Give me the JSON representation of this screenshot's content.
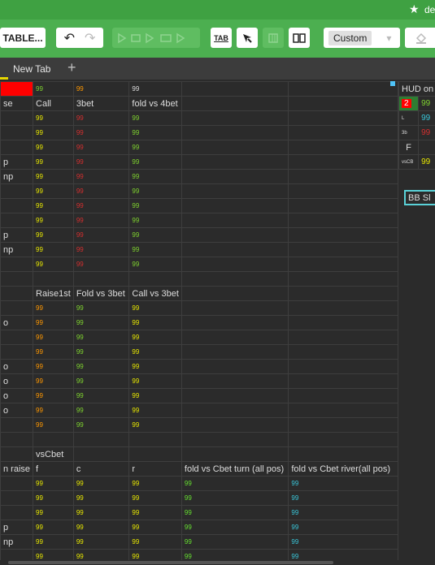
{
  "topbar": {
    "user_partial": "de",
    "star": "★"
  },
  "toolbar": {
    "table_button": "TABLE...",
    "undo": "↶",
    "redo": "↷",
    "tab_button": "TAB",
    "custom_select": "Custom",
    "custom_arrow": "▾"
  },
  "tabs": {
    "new_tab": "New Tab",
    "add": "+"
  },
  "colors": {
    "yellow": "#e8e800",
    "red": "#d32f2f",
    "green": "#7fd32f",
    "orange": "#ff9800",
    "cyan": "#39c6d9",
    "lime": "#66e030",
    "header_red": "#ff0000"
  },
  "grid": {
    "rows": [
      {
        "a": "",
        "b": "99",
        "c": "99",
        "d": "99",
        "e": "",
        "f": "",
        "g": "",
        "styles": [
          "red",
          "green",
          "orange",
          "white",
          "",
          "",
          ""
        ]
      },
      {
        "a": "se",
        "b": "Call",
        "c": "3bet",
        "d": "fold vs 4bet",
        "e": "",
        "f": "",
        "g": "",
        "styles": [
          "lbl",
          "lbl",
          "lbl",
          "lbl",
          "",
          "",
          ""
        ]
      },
      {
        "a": "",
        "b": "99",
        "c": "99",
        "d": "99",
        "e": "",
        "f": "",
        "g": "",
        "styles": [
          "",
          "yellow",
          "red",
          "green",
          "",
          "",
          ""
        ]
      },
      {
        "a": "",
        "b": "99",
        "c": "99",
        "d": "99",
        "e": "",
        "f": "",
        "g": "",
        "styles": [
          "",
          "yellow",
          "red",
          "green",
          "",
          "",
          ""
        ]
      },
      {
        "a": "",
        "b": "99",
        "c": "99",
        "d": "99",
        "e": "",
        "f": "",
        "g": "",
        "styles": [
          "",
          "yellow",
          "red",
          "green",
          "",
          "",
          ""
        ]
      },
      {
        "a": "p",
        "b": "99",
        "c": "99",
        "d": "99",
        "e": "",
        "f": "",
        "g": "",
        "styles": [
          "lbl",
          "yellow",
          "red",
          "green",
          "",
          "",
          ""
        ]
      },
      {
        "a": "np",
        "b": "99",
        "c": "99",
        "d": "99",
        "e": "",
        "f": "",
        "g": "",
        "styles": [
          "lbl",
          "yellow",
          "red",
          "green",
          "",
          "",
          ""
        ]
      },
      {
        "a": "",
        "b": "99",
        "c": "99",
        "d": "99",
        "e": "",
        "f": "",
        "g": "",
        "styles": [
          "",
          "yellow",
          "red",
          "green",
          "",
          "",
          ""
        ]
      },
      {
        "a": "",
        "b": "99",
        "c": "99",
        "d": "99",
        "e": "",
        "f": "",
        "g": "",
        "styles": [
          "",
          "yellow",
          "red",
          "green",
          "",
          "",
          ""
        ]
      },
      {
        "a": "",
        "b": "99",
        "c": "99",
        "d": "99",
        "e": "",
        "f": "",
        "g": "",
        "styles": [
          "",
          "yellow",
          "red",
          "green",
          "",
          "",
          ""
        ]
      },
      {
        "a": "p",
        "b": "99",
        "c": "99",
        "d": "99",
        "e": "",
        "f": "",
        "g": "",
        "styles": [
          "lbl",
          "yellow",
          "red",
          "green",
          "",
          "",
          ""
        ]
      },
      {
        "a": "np",
        "b": "99",
        "c": "99",
        "d": "99",
        "e": "",
        "f": "",
        "g": "",
        "styles": [
          "lbl",
          "yellow",
          "red",
          "green",
          "",
          "",
          ""
        ]
      },
      {
        "a": "",
        "b": "99",
        "c": "99",
        "d": "99",
        "e": "",
        "f": "",
        "g": "",
        "styles": [
          "",
          "yellow",
          "red",
          "green",
          "",
          "",
          ""
        ]
      },
      {
        "a": "",
        "b": "",
        "c": "",
        "d": "",
        "e": "",
        "f": "",
        "g": "",
        "styles": [
          "",
          "",
          "",
          "",
          "",
          "",
          ""
        ]
      },
      {
        "a": "",
        "b": "Raise1st",
        "c": "Fold vs 3bet",
        "d": "Call vs 3bet",
        "e": "",
        "f": "",
        "g": "",
        "styles": [
          "",
          "lbl",
          "lbl",
          "lbl",
          "",
          "",
          ""
        ]
      },
      {
        "a": "",
        "b": "99",
        "c": "99",
        "d": "99",
        "e": "",
        "f": "",
        "g": "",
        "styles": [
          "",
          "orange",
          "green",
          "yellow",
          "",
          "",
          ""
        ]
      },
      {
        "a": "o",
        "b": "99",
        "c": "99",
        "d": "99",
        "e": "",
        "f": "",
        "g": "",
        "styles": [
          "lbl",
          "orange",
          "green",
          "yellow",
          "",
          "",
          ""
        ]
      },
      {
        "a": "",
        "b": "99",
        "c": "99",
        "d": "99",
        "e": "",
        "f": "",
        "g": "",
        "styles": [
          "",
          "orange",
          "green",
          "yellow",
          "",
          "",
          ""
        ]
      },
      {
        "a": "",
        "b": "99",
        "c": "99",
        "d": "99",
        "e": "",
        "f": "",
        "g": "",
        "styles": [
          "",
          "orange",
          "green",
          "yellow",
          "",
          "",
          ""
        ]
      },
      {
        "a": "o",
        "b": "99",
        "c": "99",
        "d": "99",
        "e": "",
        "f": "",
        "g": "",
        "styles": [
          "lbl",
          "orange",
          "green",
          "yellow",
          "",
          "",
          ""
        ]
      },
      {
        "a": "o",
        "b": "99",
        "c": "99",
        "d": "99",
        "e": "",
        "f": "",
        "g": "",
        "styles": [
          "lbl",
          "orange",
          "green",
          "yellow",
          "",
          "",
          ""
        ]
      },
      {
        "a": "o",
        "b": "99",
        "c": "99",
        "d": "99",
        "e": "",
        "f": "",
        "g": "",
        "styles": [
          "lbl",
          "orange",
          "green",
          "yellow",
          "",
          "",
          ""
        ]
      },
      {
        "a": "o",
        "b": "99",
        "c": "99",
        "d": "99",
        "e": "",
        "f": "",
        "g": "",
        "styles": [
          "lbl",
          "orange",
          "green",
          "yellow",
          "",
          "",
          ""
        ]
      },
      {
        "a": "",
        "b": "99",
        "c": "99",
        "d": "99",
        "e": "",
        "f": "",
        "g": "",
        "styles": [
          "",
          "orange",
          "green",
          "yellow",
          "",
          "",
          ""
        ]
      },
      {
        "a": "",
        "b": "",
        "c": "",
        "d": "",
        "e": "",
        "f": "",
        "g": "",
        "styles": [
          "",
          "",
          "",
          "",
          "",
          "",
          ""
        ]
      },
      {
        "a": "",
        "b": "vsCbet",
        "c": "",
        "d": "",
        "e": "",
        "f": "",
        "g": "",
        "styles": [
          "",
          "lbl",
          "",
          "",
          "",
          "",
          ""
        ]
      },
      {
        "a": "n raise",
        "b": "f",
        "c": "c",
        "d": "r",
        "e": "fold vs Cbet turn  (all pos)",
        "f": "fold vs Cbet river(all pos)",
        "g": "",
        "styles": [
          "lbl",
          "lbl",
          "lbl",
          "lbl",
          "lbl",
          "lbl",
          ""
        ]
      },
      {
        "a": "",
        "b": "99",
        "c": "99",
        "d": "99",
        "e": "99",
        "f": "99",
        "g": "",
        "styles": [
          "",
          "yellow",
          "yellow",
          "yellow",
          "lime",
          "cyan",
          ""
        ]
      },
      {
        "a": "",
        "b": "99",
        "c": "99",
        "d": "99",
        "e": "99",
        "f": "99",
        "g": "",
        "styles": [
          "",
          "yellow",
          "yellow",
          "yellow",
          "lime",
          "cyan",
          ""
        ]
      },
      {
        "a": "",
        "b": "99",
        "c": "99",
        "d": "99",
        "e": "99",
        "f": "99",
        "g": "",
        "styles": [
          "",
          "yellow",
          "yellow",
          "yellow",
          "lime",
          "cyan",
          ""
        ]
      },
      {
        "a": "p",
        "b": "99",
        "c": "99",
        "d": "99",
        "e": "99",
        "f": "99",
        "g": "",
        "styles": [
          "lbl",
          "yellow",
          "yellow",
          "yellow",
          "lime",
          "cyan",
          ""
        ]
      },
      {
        "a": "np",
        "b": "99",
        "c": "99",
        "d": "99",
        "e": "99",
        "f": "99",
        "g": "",
        "styles": [
          "lbl",
          "yellow",
          "yellow",
          "yellow",
          "lime",
          "cyan",
          ""
        ]
      },
      {
        "a": "",
        "b": "99",
        "c": "99",
        "d": "99",
        "e": "99",
        "f": "99",
        "g": "",
        "styles": [
          "",
          "yellow",
          "yellow",
          "yellow",
          "lime",
          "cyan",
          ""
        ]
      }
    ]
  },
  "hud": {
    "title": "HUD on",
    "rows": [
      {
        "k": "2",
        "v": "99",
        "kstyle": "badge",
        "vstyle": "green"
      },
      {
        "k": "L",
        "v": "99",
        "kstyle": "small",
        "vstyle": "cyan"
      },
      {
        "k": "3b",
        "v": "99",
        "kstyle": "small",
        "vstyle": "red"
      },
      {
        "k": "F",
        "v": "",
        "kstyle": "big",
        "vstyle": ""
      },
      {
        "k": "vsCB",
        "v": "99",
        "kstyle": "small",
        "vstyle": "yellow"
      }
    ],
    "bb_box": "BB  Sl"
  }
}
